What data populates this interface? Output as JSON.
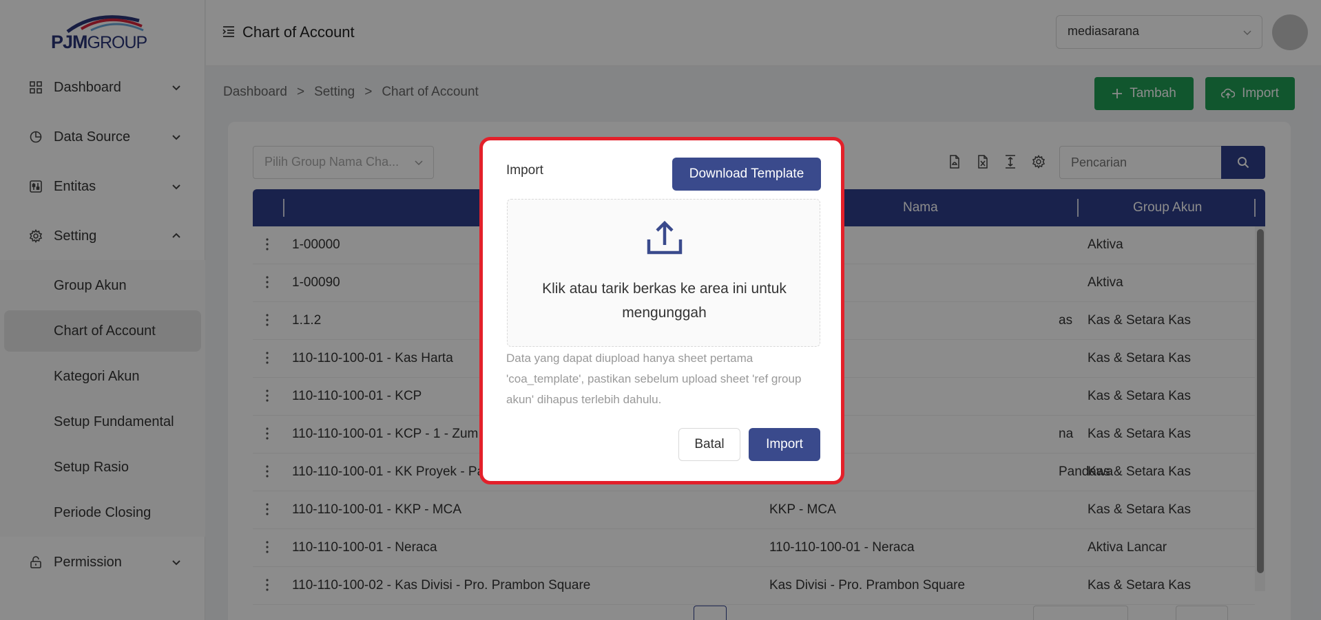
{
  "brand": {
    "logo_text_1": "PJM",
    "logo_text_2": "GROUP"
  },
  "sidebar": {
    "items": [
      {
        "label": "Dashboard",
        "icon": "grid-icon"
      },
      {
        "label": "Data Source",
        "icon": "pie-chart-icon"
      },
      {
        "label": "Entitas",
        "icon": "sliders-icon"
      },
      {
        "label": "Setting",
        "icon": "gear-icon"
      },
      {
        "label": "Permission",
        "icon": "lock-icon"
      }
    ],
    "setting_sub": [
      {
        "label": "Group Akun"
      },
      {
        "label": "Chart of Account"
      },
      {
        "label": "Kategori Akun"
      },
      {
        "label": "Setup Fundamental"
      },
      {
        "label": "Setup Rasio"
      },
      {
        "label": "Periode Closing"
      }
    ]
  },
  "header": {
    "title": "Chart of Account",
    "company": "mediasarana"
  },
  "breadcrumb": [
    "Dashboard",
    ">",
    "Setting",
    ">",
    "Chart of Account"
  ],
  "actions": {
    "add_label": "Tambah",
    "import_label": "Import"
  },
  "toolbar": {
    "group_placeholder": "Pilih Group Nama Cha...",
    "search_placeholder": "Pencarian"
  },
  "table": {
    "columns": [
      "Nama",
      "Group Akun"
    ],
    "rows": [
      {
        "code": "1-00000",
        "nama": "",
        "group": "Aktiva"
      },
      {
        "code": "1-00090",
        "nama": "",
        "group": "Aktiva"
      },
      {
        "code": "1.1.2",
        "nama": "as",
        "group": "Kas & Setara Kas"
      },
      {
        "code": "110-110-100-01 - Kas Harta",
        "nama": "",
        "group": "Kas & Setara Kas"
      },
      {
        "code": "110-110-100-01 - KCP",
        "nama": "",
        "group": "Kas & Setara Kas"
      },
      {
        "code": "110-110-100-01 - KCP - 1 - Zum",
        "nama": "na",
        "group": "Kas & Setara Kas"
      },
      {
        "code": "110-110-100-01 - KK Proyek - Pa",
        "nama": "Pandawa",
        "group": "Kas & Setara Kas"
      },
      {
        "code": "110-110-100-01 - KKP - MCA",
        "nama": "KKP - MCA",
        "group": "Kas & Setara Kas"
      },
      {
        "code": "110-110-100-01 - Neraca",
        "nama": "110-110-100-01 - Neraca",
        "group": "Aktiva Lancar"
      },
      {
        "code": "110-110-100-02 - Kas Divisi - Pro. Prambon Square",
        "nama": "Kas Divisi - Pro. Prambon Square",
        "group": "Kas & Setara Kas"
      }
    ]
  },
  "modal": {
    "title": "Import",
    "template_button": "Download Template",
    "drop_text": "Klik atau tarik berkas ke area ini untuk mengunggah",
    "hint": "Data yang dapat diupload hanya sheet pertama 'coa_template', pastikan sebelum upload sheet 'ref group akun' dihapus terlebih dahulu.",
    "cancel_button": "Batal",
    "import_button": "Import"
  },
  "colors": {
    "primary": "#2f3f8a",
    "success": "#1f9d55",
    "highlight_border": "#e3202a"
  }
}
